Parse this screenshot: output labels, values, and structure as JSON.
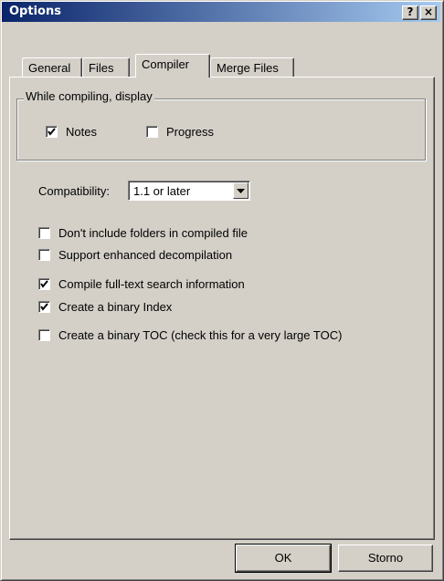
{
  "window": {
    "title": "Options",
    "help_button": "?",
    "close_button": "×"
  },
  "tabs": [
    {
      "label": "General",
      "active": false
    },
    {
      "label": "Files",
      "active": false
    },
    {
      "label": "Compiler",
      "active": true
    },
    {
      "label": "Merge Files",
      "active": false
    }
  ],
  "compile_display": {
    "legend": "While compiling, display",
    "notes": {
      "label": "Notes",
      "checked": true
    },
    "progress": {
      "label": "Progress",
      "checked": false
    }
  },
  "compatibility": {
    "label": "Compatibility:",
    "value": "1.1 or later"
  },
  "options": [
    {
      "label": "Don't include folders in compiled file",
      "checked": false
    },
    {
      "label": "Support enhanced decompilation",
      "checked": false
    },
    {
      "label": "Compile full-text search information",
      "checked": true
    },
    {
      "label": "Create a binary Index",
      "checked": true
    },
    {
      "label": "Create a binary TOC (check this for a very large TOC)",
      "checked": false
    }
  ],
  "buttons": {
    "ok": "OK",
    "cancel": "Storno"
  }
}
